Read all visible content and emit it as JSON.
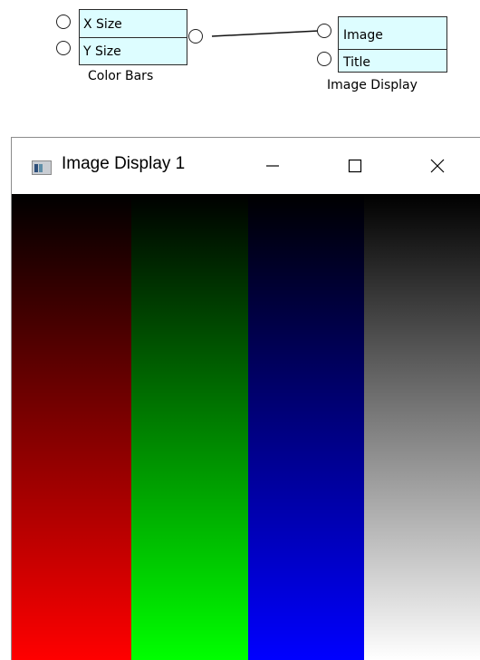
{
  "color_bars_block": {
    "inputs": [
      "X Size",
      "Y Size"
    ],
    "caption": "Color Bars"
  },
  "image_display_block": {
    "inputs": [
      "Image",
      "Title"
    ],
    "caption": "Image Display"
  },
  "window": {
    "title": "Image Display 1",
    "controls": [
      "minimize-icon",
      "maximize-icon",
      "close-icon"
    ]
  },
  "image": {
    "bars": [
      {
        "name": "red",
        "color": "#ff0000"
      },
      {
        "name": "green",
        "color": "#00ff00"
      },
      {
        "name": "blue",
        "color": "#0000ff"
      },
      {
        "name": "white",
        "color": "#ffffff"
      }
    ],
    "gradient_from": "#000000"
  }
}
